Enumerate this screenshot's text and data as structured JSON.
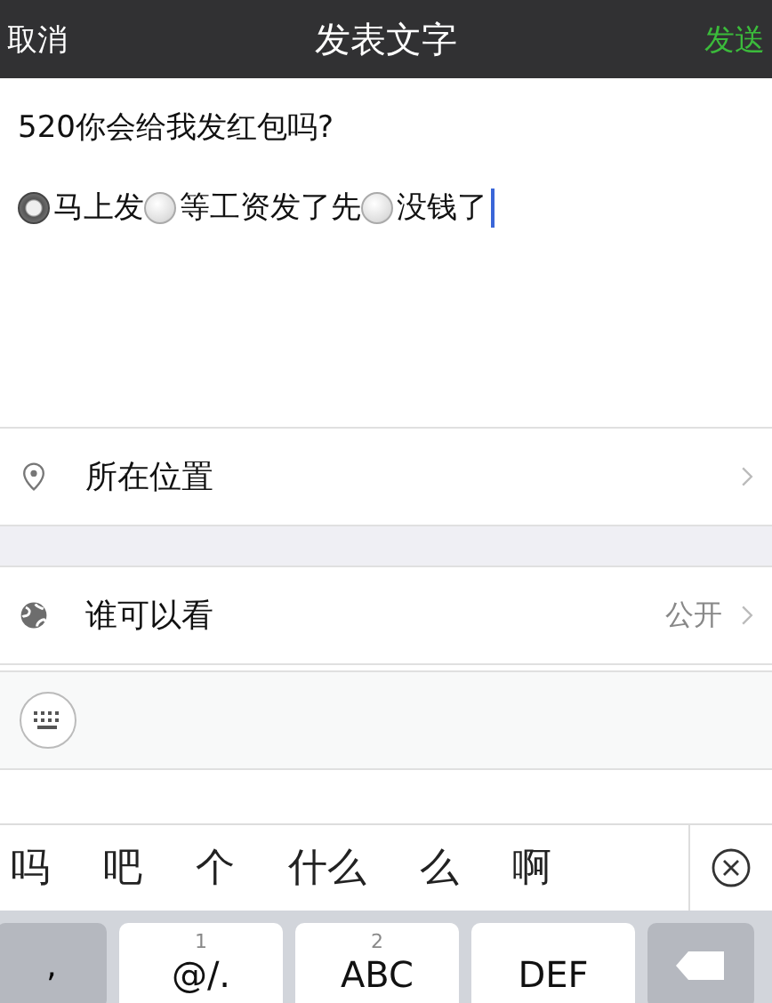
{
  "header": {
    "cancel": "取消",
    "title": "发表文字",
    "send": "发送"
  },
  "post": {
    "question": "520你会给我发红包吗?",
    "options": [
      {
        "label": "马上发",
        "selected": true
      },
      {
        "label": "等工资发了先",
        "selected": false
      },
      {
        "label": "没钱了",
        "selected": false
      }
    ]
  },
  "rows": [
    {
      "kind": "location",
      "label": "所在位置"
    },
    {
      "kind": "visibility",
      "label": "谁可以看",
      "value": "公开"
    }
  ],
  "candidates": [
    "吗",
    "吧",
    "个",
    "什么",
    "么",
    "啊"
  ],
  "keys": [
    {
      "kind": "function",
      "label": ","
    },
    {
      "kind": "letter",
      "number": "1",
      "label": "@/."
    },
    {
      "kind": "letter",
      "number": "2",
      "label": "ABC"
    },
    {
      "kind": "letter",
      "label": "DEF"
    },
    {
      "kind": "delete"
    }
  ]
}
